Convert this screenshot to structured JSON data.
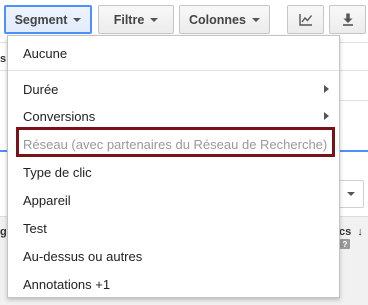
{
  "toolbar": {
    "segment_label": "Segment",
    "filter_label": "Filtre",
    "columns_label": "Colonnes",
    "chart_icon": "line-chart-icon",
    "download_icon": "download-icon"
  },
  "background": {
    "left_clipped_header": "s",
    "left_clipped_column": "g",
    "right_column_header": "cs"
  },
  "segment_menu": {
    "items": [
      {
        "label": "Aucune",
        "disabled": false,
        "has_submenu": false
      },
      {
        "label": "Durée",
        "disabled": false,
        "has_submenu": true
      },
      {
        "label": "Conversions",
        "disabled": false,
        "has_submenu": true
      },
      {
        "label": "Réseau (avec partenaires du Réseau de Recherche)",
        "disabled": true,
        "has_submenu": false,
        "highlighted": true
      },
      {
        "label": "Type de clic",
        "disabled": false,
        "has_submenu": false
      },
      {
        "label": "Appareil",
        "disabled": false,
        "has_submenu": false
      },
      {
        "label": "Test",
        "disabled": false,
        "has_submenu": false
      },
      {
        "label": "Au-dessus ou autres",
        "disabled": false,
        "has_submenu": false
      },
      {
        "label": "Annotations +1",
        "disabled": false,
        "has_submenu": false
      }
    ]
  },
  "colors": {
    "highlight_border": "#7a1018",
    "accent_blue": "#4d90fe",
    "disabled_text": "#9a9a9a"
  }
}
